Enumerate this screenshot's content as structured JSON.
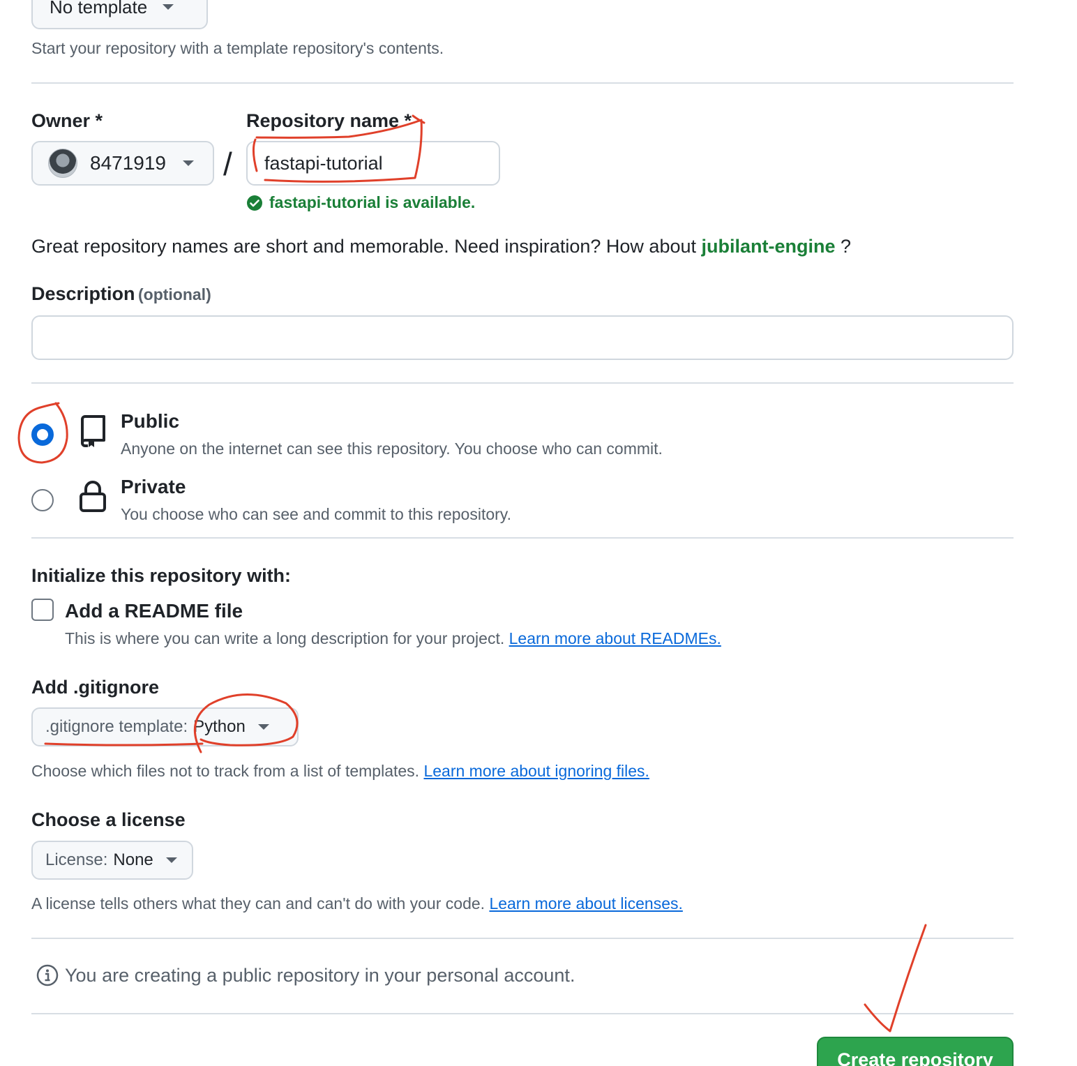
{
  "template": {
    "dropdown_label": "No template",
    "help": "Start your repository with a template repository's contents."
  },
  "owner": {
    "label": "Owner *",
    "value": "8471919"
  },
  "separator": "/",
  "repo_name": {
    "label": "Repository name *",
    "value": "fastapi-tutorial",
    "availability": "fastapi-tutorial is available."
  },
  "inspiration": {
    "text": "Great repository names are short and memorable. Need inspiration? How about",
    "suggestion": "jubilant-engine",
    "suffix": "?"
  },
  "description": {
    "label": "Description",
    "optional": "(optional)",
    "value": ""
  },
  "visibility": {
    "selected": "public",
    "public": {
      "title": "Public",
      "desc": "Anyone on the internet can see this repository. You choose who can commit."
    },
    "private": {
      "title": "Private",
      "desc": "You choose who can see and commit to this repository."
    }
  },
  "initialize": {
    "heading": "Initialize this repository with:",
    "readme": {
      "title": "Add a README file",
      "desc": "This is where you can write a long description for your project.",
      "link": "Learn more about READMEs.",
      "checked": false
    }
  },
  "gitignore": {
    "heading": "Add .gitignore",
    "prefix": ".gitignore template:",
    "value": "Python",
    "help": "Choose which files not to track from a list of templates.",
    "link": "Learn more about ignoring files."
  },
  "license": {
    "heading": "Choose a license",
    "prefix": "License:",
    "value": "None",
    "help": "A license tells others what they can and can't do with your code.",
    "link": "Learn more about licenses."
  },
  "notice": "You are creating a public repository in your personal account.",
  "submit_label": "Create repository",
  "colors": {
    "accent_blue": "#0969da",
    "success_green": "#1a7f37",
    "button_green": "#2da44e",
    "annotation_red": "#e0402a"
  }
}
